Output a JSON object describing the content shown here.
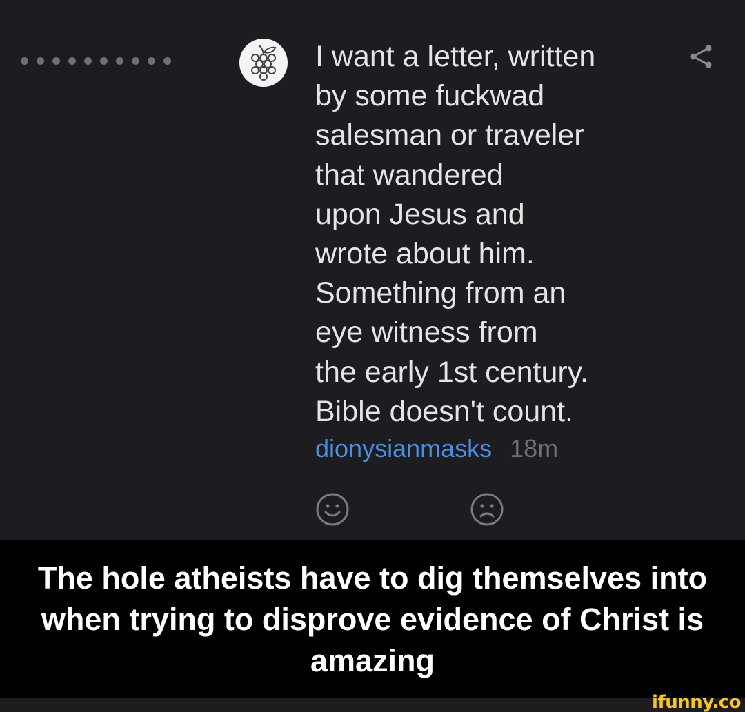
{
  "post": {
    "message": "I want a letter, written\nby some fuckwad\nsalesman or traveler\nthat wandered\nupon Jesus and\nwrote about him.\nSomething from an\neye witness from\nthe early 1st century.\nBible doesn't count.",
    "author": "dionysianmasks",
    "time": "18m",
    "avatar_icon": "grapes-icon",
    "share_icon": "share-icon",
    "reactions": [
      "smiley-face-icon",
      "sad-face-icon"
    ]
  },
  "caption": {
    "text": "The hole atheists have to dig themselves into when trying to disprove evidence of Christ is amazing"
  },
  "watermark": {
    "text": "ifunny.co"
  },
  "colors": {
    "background": "#1c1c21",
    "text": "#e4e4e6",
    "link": "#4a90e2",
    "muted": "#6f6f75",
    "caption_bg": "#000000",
    "watermark": "#f7c32e"
  }
}
